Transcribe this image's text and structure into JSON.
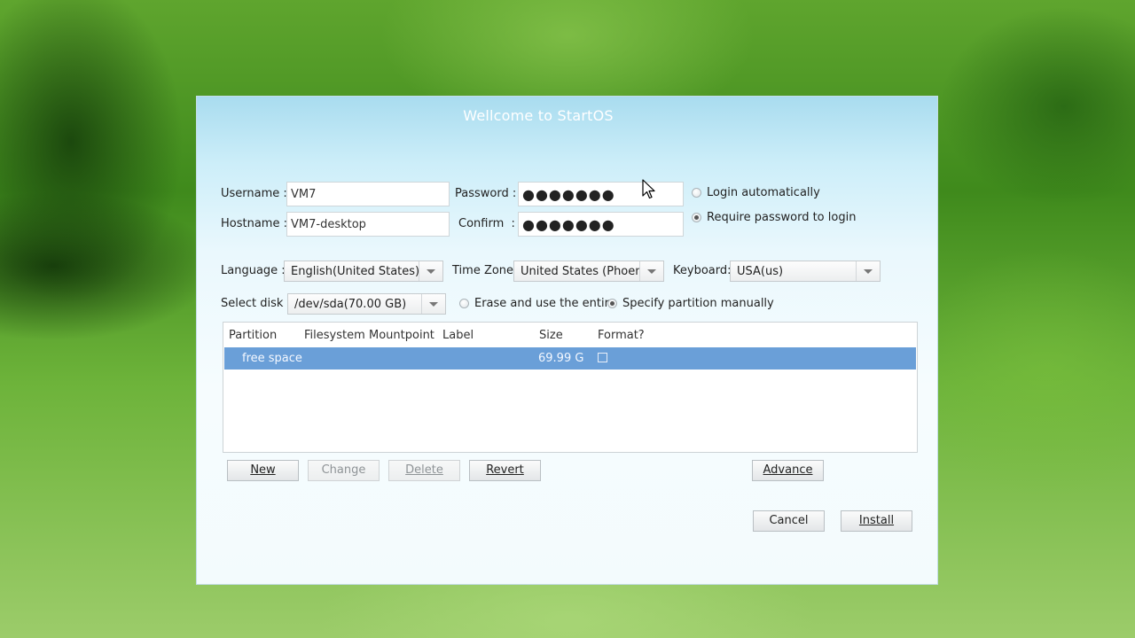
{
  "window": {
    "title": "Wellcome to StartOS"
  },
  "account": {
    "username_label": "Username :",
    "username_value": "VM7",
    "hostname_label": "Hostname :",
    "hostname_value": "VM7-desktop",
    "password_label": "Password :",
    "password_value": "●●●●●●●",
    "confirm_label": "Confirm  :",
    "confirm_value": "●●●●●●●",
    "login_options": [
      {
        "label": "Login automatically",
        "selected": false
      },
      {
        "label": "Require password to login",
        "selected": true
      }
    ]
  },
  "locale": {
    "language_label": "Language :",
    "language_value": "English(United States)",
    "timezone_label": "Time Zone:",
    "timezone_value": "United States (Phoenix)",
    "keyboard_label": "Keyboard:",
    "keyboard_value": "USA(us)"
  },
  "disk": {
    "select_label": "Select disk :",
    "select_value": "/dev/sda(70.00 GB)",
    "modes": [
      {
        "label": "Erase and use the entire",
        "selected": false
      },
      {
        "label": "Specify partition manually",
        "selected": true
      }
    ]
  },
  "partitions": {
    "columns": [
      "Partition",
      "Filesystem",
      "Mountpoint",
      "Label",
      "Size",
      "Format?"
    ],
    "rows": [
      {
        "partition": "free space",
        "filesystem": "",
        "mountpoint": "",
        "label": "",
        "size": "69.99 G",
        "format": false
      }
    ]
  },
  "buttons": {
    "new": "New",
    "change": "Change",
    "delete": "Delete",
    "revert": "Revert",
    "advance": "Advance",
    "cancel": "Cancel",
    "install": "Install"
  },
  "icons": {
    "cursor": "mouse-pointer-icon",
    "dropdown": "chevron-down-icon"
  },
  "colors": {
    "selection": "#6a9fd8",
    "title_text": "#ffffff"
  }
}
